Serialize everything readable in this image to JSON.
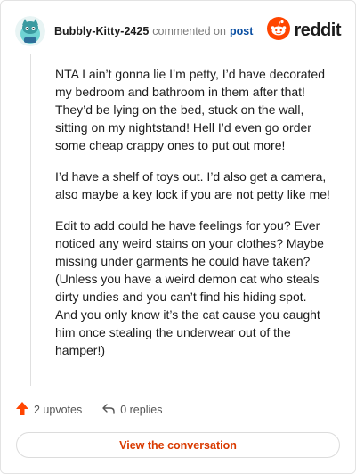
{
  "header": {
    "username": "Bubbly-Kitty-2425",
    "commented_on": "commented on",
    "post_link": "post",
    "brand_name": "reddit"
  },
  "comment": {
    "paragraphs": [
      "NTA I ain’t gonna lie I’m petty, I’d have decorated my bedroom and bathroom in them after that! They’d be lying on the bed, stuck on the wall, sitting on my nightstand! Hell I’d even go order some cheap crappy ones to put out more!",
      "I’d have a shelf of toys out. I’d also get a camera, also maybe a key lock if you are not petty like me!",
      "Edit to add could he have feelings for you? Ever noticed any weird stains on your clothes? Maybe missing under garments he could have taken? (Unless you have a weird demon cat who steals dirty undies and you can’t find his hiding spot. And you only know it’s the cat cause you caught him once stealing the underwear out of the hamper!)"
    ]
  },
  "actions": {
    "upvotes": "2 upvotes",
    "replies": "0 replies"
  },
  "cta": {
    "label": "View the conversation"
  },
  "colors": {
    "brand_orange": "#ff4500",
    "upvote_orange": "#ff4500",
    "link_blue": "#0a4fa3",
    "cta_text": "#d93a00",
    "avatar_bg": "#6fd3d3"
  },
  "icons": {
    "avatar": "snoo-avatar-icon",
    "brand": "reddit-logo-icon",
    "upvote": "upvote-arrow-icon",
    "reply": "reply-arrow-icon"
  }
}
